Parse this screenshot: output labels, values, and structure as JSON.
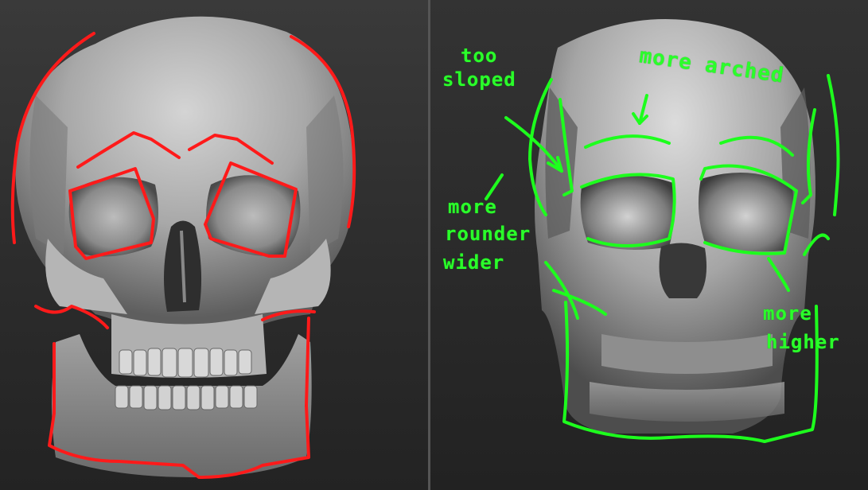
{
  "left_panel": {
    "outline_color": "#ff1a1a",
    "subject": "skull-reference"
  },
  "right_panel": {
    "outline_color": "#1dff1d",
    "subject": "skull-sculpt",
    "annotations": {
      "too_sloped_line1": "too",
      "too_sloped_line2": "sloped",
      "more_arched": "more arched",
      "more_rounder_line1": "more",
      "more_rounder_line2": "rounder",
      "more_rounder_line3": "wider",
      "more_higher_line1": "more",
      "more_higher_line2": "higher"
    }
  }
}
